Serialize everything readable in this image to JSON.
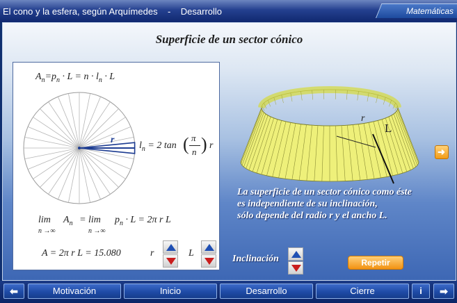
{
  "header": {
    "title": "El cono y la esfera, según Arquímedes    -    Desarrollo",
    "subject": "Matemáticas"
  },
  "main": {
    "section_title": "Superficie de un sector cónico",
    "formulas": {
      "area_sum": "A",
      "area_sum_sub": "n",
      "area_sum_rest": "=p",
      "area_sum_rest_sub": "n",
      "area_sum_tail": "· L = n · l",
      "area_sum_tail_sub": "n",
      "area_sum_end": "· L",
      "ln_label": "l",
      "ln_sub": "n",
      "ln_eq": "= 2 tan",
      "ln_pi": "π",
      "ln_n": "n",
      "ln_r": "r",
      "radius_label": "r",
      "lim1": "lim",
      "lim1_sub": "n →∞",
      "lim1_A": "A",
      "lim1_A_sub": "n",
      "lim_eq": "=",
      "lim2": "lim",
      "lim2_sub": "n →∞",
      "lim2_p": "p",
      "lim2_p_sub": "n",
      "lim_tail": "· L = 2π r L",
      "result": "A = 2π r L = 15.080",
      "r_control_label": "r",
      "L_control_label": "L"
    },
    "cone_labels": {
      "r": "r",
      "L": "L"
    },
    "description": [
      "La superficie de un sector cónico como éste",
      "es independiente de su inclinación,",
      "sólo depende del radio  r  y el ancho  L."
    ],
    "inclination_label": "Inclinación",
    "repeat_label": "Repetir"
  },
  "nav": {
    "prev_icon": "arrow-left-icon",
    "buttons": [
      "Motivación",
      "Inicio",
      "Desarrollo",
      "Cierre"
    ],
    "info_label": "i",
    "next_icon": "arrow-right-icon"
  },
  "colors": {
    "cone_fill": "#eef07a",
    "cone_rim": "#d6da3a",
    "stepper_up": "#1f4fb3",
    "stepper_down": "#c91d1d",
    "accent_orange": "#f29213"
  }
}
